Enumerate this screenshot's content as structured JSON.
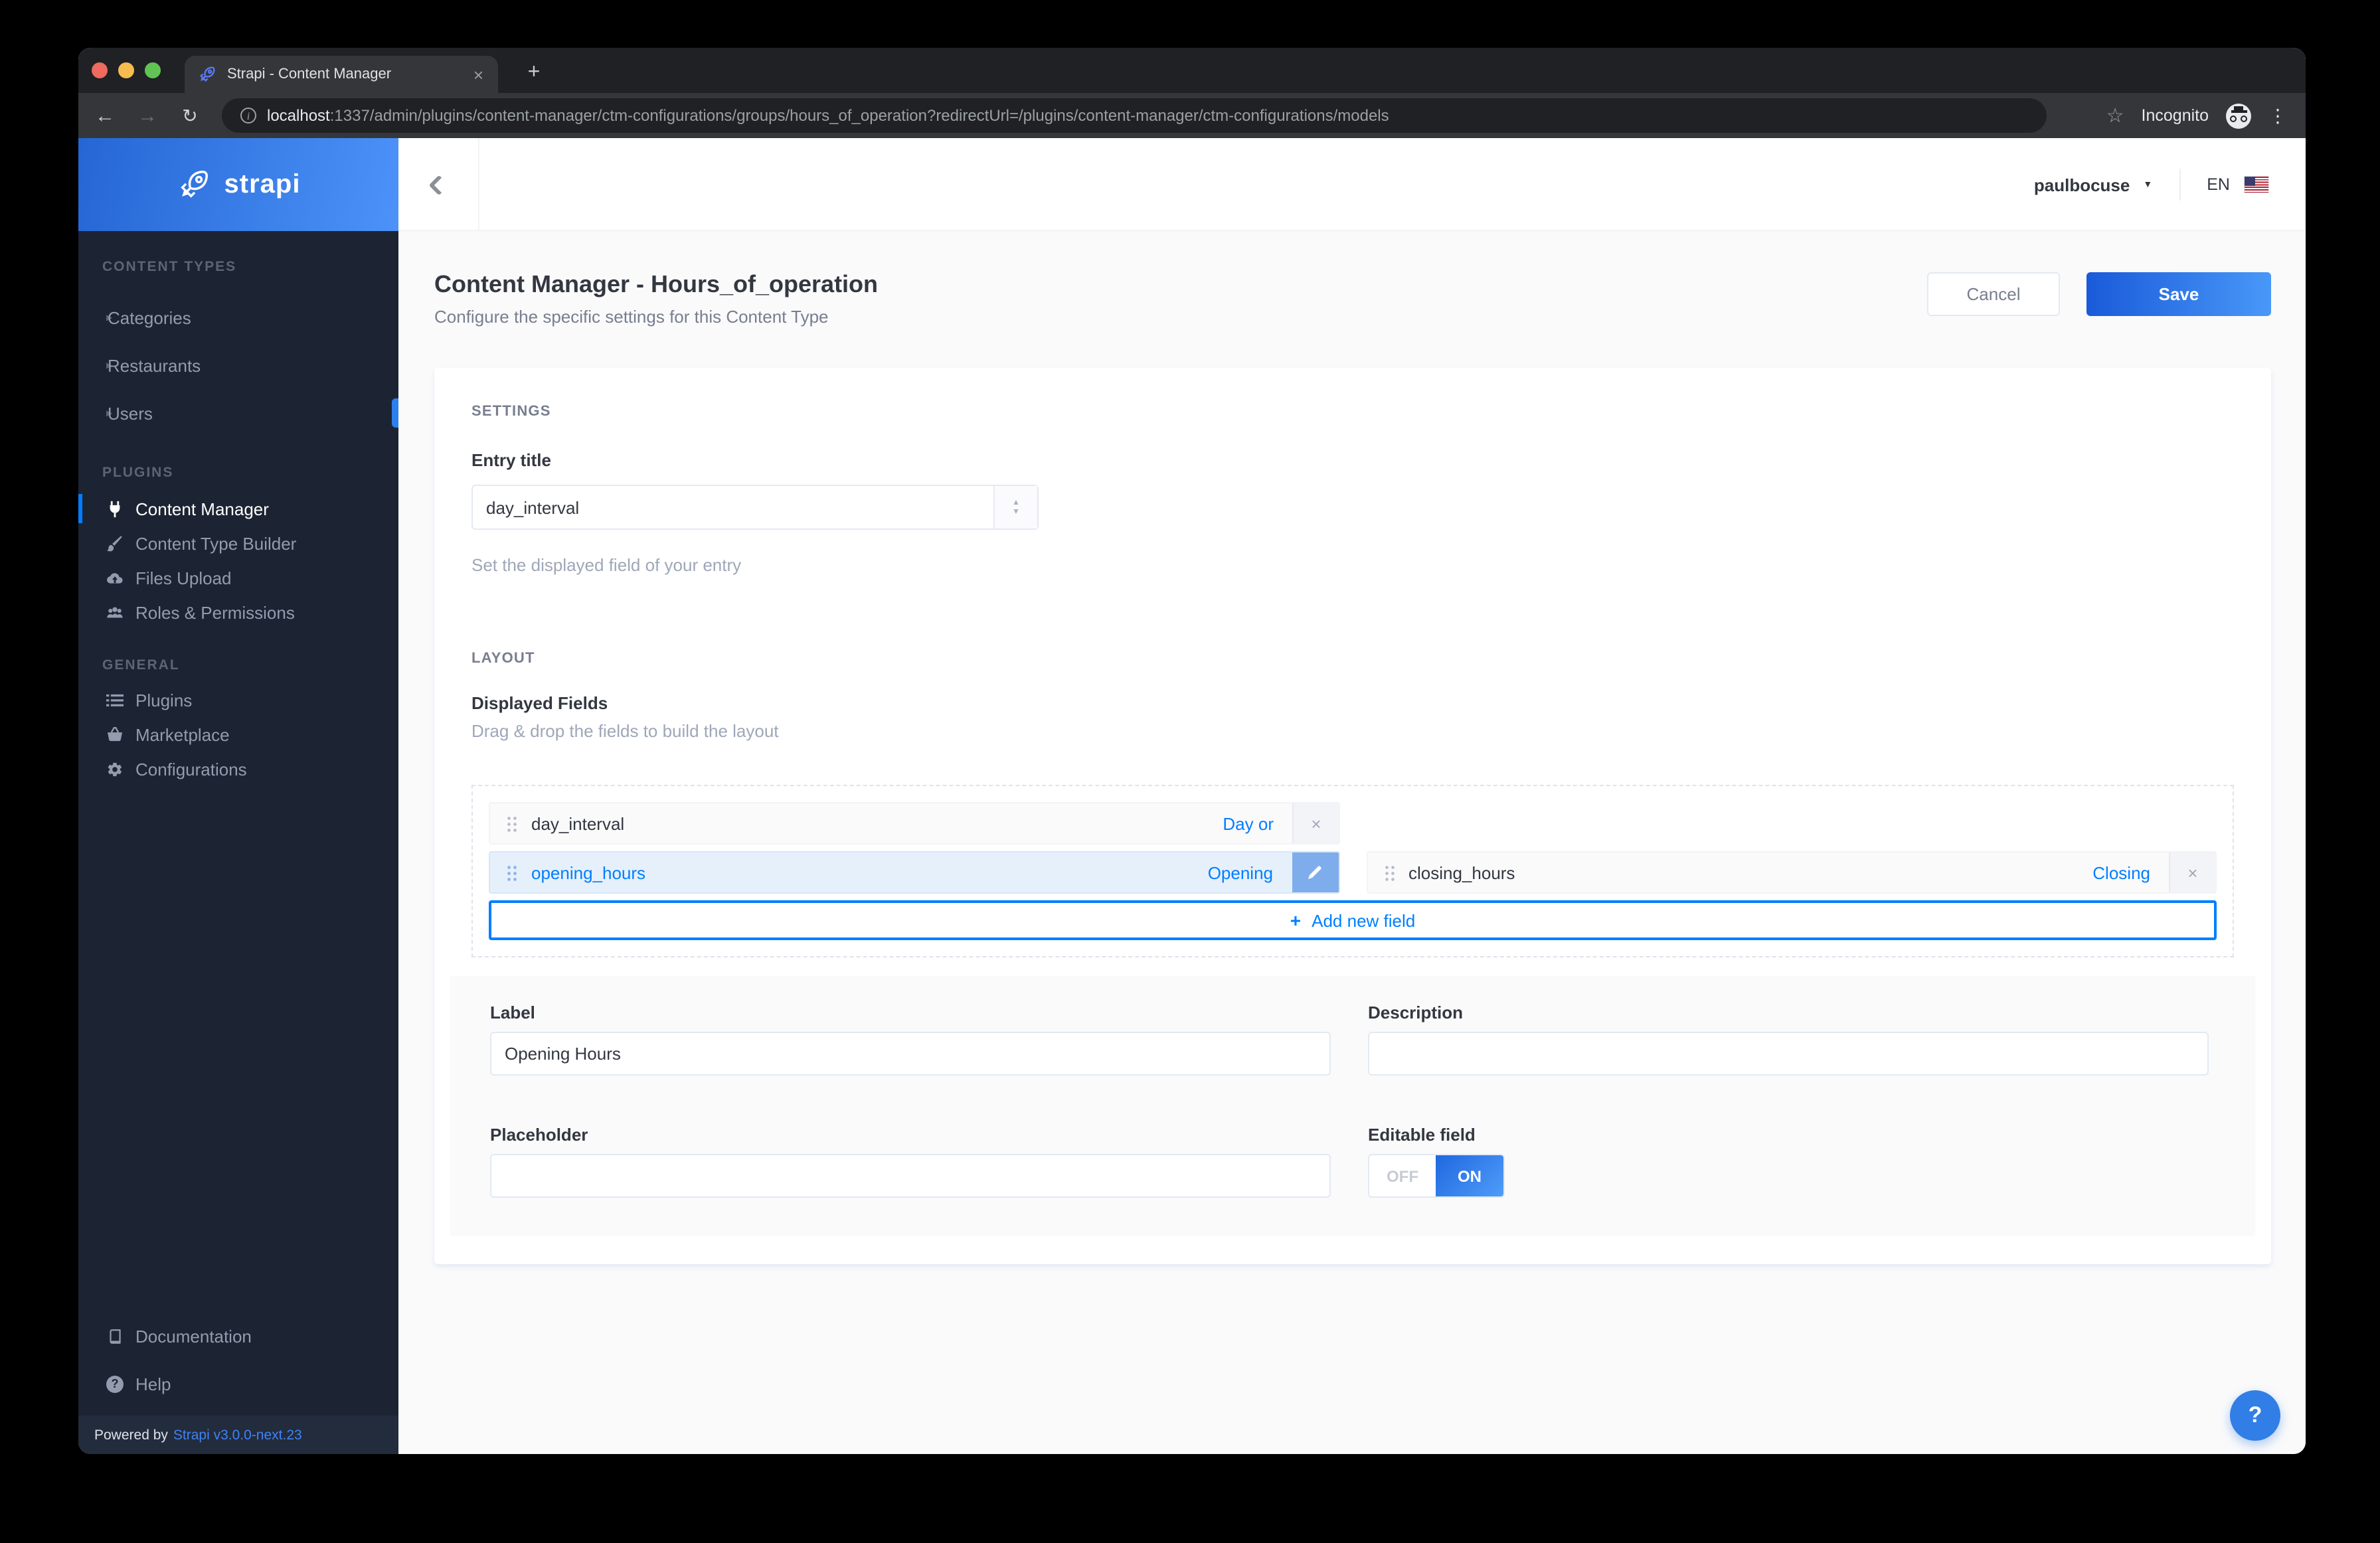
{
  "colors": {
    "accent": "#007eff",
    "sidebar_bg": "#1c2433",
    "logo_gradient": [
      "#2566d4",
      "#4c92f9"
    ],
    "save_gradient": [
      "#1a5ad9",
      "#4898f8"
    ],
    "selected_field_bg": "#e6f0fb",
    "content_bg": "#fafafb"
  },
  "icons": {
    "back": "←",
    "forward": "→",
    "reload": "↻",
    "star": "☆",
    "menu": "⋮",
    "new_tab": "+",
    "close_tab": "×",
    "caret_down": "▼",
    "item_arrow": "▶",
    "select_up": "▲",
    "select_down": "▼",
    "remove": "×",
    "help": "?",
    "add": "+",
    "info": "i"
  },
  "browser": {
    "tab_title": "Strapi - Content Manager",
    "url_host": "localhost",
    "url_path": ":1337/admin/plugins/content-manager/ctm-configurations/groups/hours_of_operation?redirectUrl=/plugins/content-manager/ctm-configurations/models",
    "incognito_label": "Incognito"
  },
  "sidebar": {
    "logo_text": "strapi",
    "sections": [
      {
        "label": "CONTENT TYPES",
        "items": [
          {
            "label": "Categories"
          },
          {
            "label": "Restaurants"
          },
          {
            "label": "Users"
          }
        ]
      },
      {
        "label": "PLUGINS",
        "items": [
          {
            "label": "Content Manager",
            "active": true
          },
          {
            "label": "Content Type Builder"
          },
          {
            "label": "Files Upload"
          },
          {
            "label": "Roles & Permissions"
          }
        ]
      },
      {
        "label": "GENERAL",
        "items": [
          {
            "label": "Plugins"
          },
          {
            "label": "Marketplace"
          },
          {
            "label": "Configurations"
          }
        ]
      }
    ],
    "footer": {
      "documentation": "Documentation",
      "help": "Help",
      "powered_prefix": "Powered by",
      "powered_link": "Strapi v3.0.0-next.23"
    }
  },
  "header": {
    "username": "paulbocuse",
    "language": "EN"
  },
  "page": {
    "title": "Content Manager - Hours_of_operation",
    "subtitle": "Configure the specific settings for this Content Type",
    "cancel": "Cancel",
    "save": "Save"
  },
  "settings": {
    "heading": "SETTINGS",
    "entry_title_label": "Entry title",
    "entry_title_value": "day_interval",
    "entry_title_help": "Set the displayed field of your entry"
  },
  "layout": {
    "heading": "LAYOUT",
    "displayed_fields_label": "Displayed Fields",
    "displayed_fields_help": "Drag & drop the fields to build the layout",
    "fields": [
      {
        "name": "day_interval",
        "badge": "Day or",
        "selected": false
      },
      {
        "name": "opening_hours",
        "badge": "Opening",
        "selected": true
      },
      {
        "name": "closing_hours",
        "badge": "Closing",
        "selected": false
      }
    ],
    "add_field": "Add new field"
  },
  "form": {
    "label": "Label",
    "label_value": "Opening Hours",
    "description": "Description",
    "description_value": "",
    "placeholder": "Placeholder",
    "placeholder_value": "",
    "editable": "Editable field",
    "off": "OFF",
    "on": "ON",
    "editable_value": "ON"
  }
}
